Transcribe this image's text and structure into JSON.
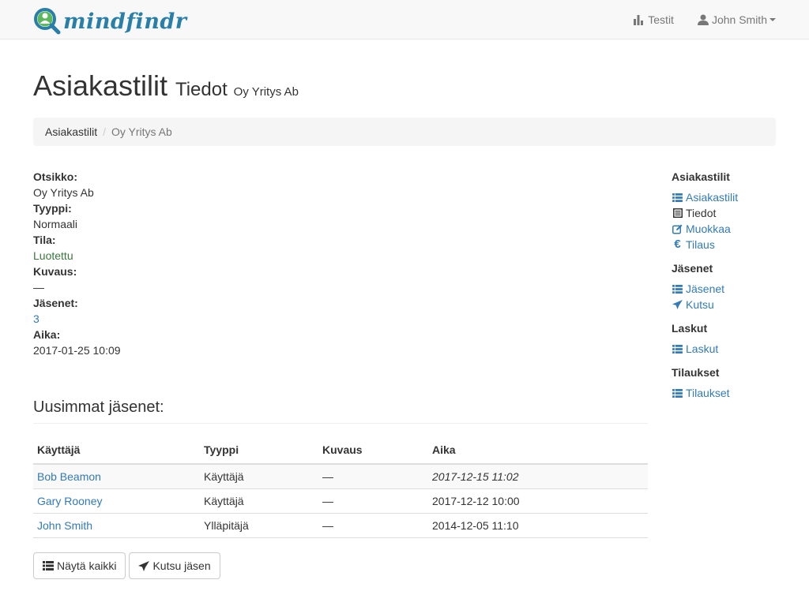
{
  "brand": {
    "name": "mindfindr"
  },
  "nav": {
    "tests_label": "Testit",
    "user_label": "John Smith"
  },
  "header": {
    "title": "Asiakastilit",
    "subtitle": "Tiedot",
    "account": "Oy Yritys Ab"
  },
  "breadcrumb": {
    "root": "Asiakastilit",
    "separator": "/",
    "current": "Oy Yritys Ab"
  },
  "details": [
    {
      "label": "Otsikko:",
      "value": "Oy Yritys Ab"
    },
    {
      "label": "Tyyppi:",
      "value": "Normaali"
    },
    {
      "label": "Tila:",
      "value": "Luotettu"
    },
    {
      "label": "Kuvaus:",
      "value": "—"
    },
    {
      "label": "Jäsenet:",
      "value": "3"
    },
    {
      "label": "Aika:",
      "value": "2017-01-25 10:09"
    }
  ],
  "members": {
    "title": "Uusimmat jäsenet:",
    "columns": [
      "Käyttäjä",
      "Tyyppi",
      "Kuvaus",
      "Aika"
    ],
    "rows": [
      {
        "user": "Bob Beamon",
        "type": "Käyttäjä",
        "desc": "—",
        "time": "2017-12-15 11:02"
      },
      {
        "user": "Gary Rooney",
        "type": "Käyttäjä",
        "desc": "—",
        "time": "2017-12-12 10:00"
      },
      {
        "user": "John Smith",
        "type": "Ylläpitäjä",
        "desc": "—",
        "time": "2014-12-05 11:10"
      }
    ],
    "show_all_label": "Näytä kaikki",
    "invite_label": "Kutsu jäsen"
  },
  "sidebar": {
    "groups": [
      {
        "heading": "Asiakastilit",
        "items": [
          {
            "label": "Asiakastilit",
            "icon": "list-icon"
          },
          {
            "label": "Tiedot",
            "icon": "details-icon"
          },
          {
            "label": "Muokkaa",
            "icon": "edit-icon"
          },
          {
            "label": "Tilaus",
            "icon": "euro-icon"
          }
        ]
      },
      {
        "heading": "Jäsenet",
        "items": [
          {
            "label": "Jäsenet",
            "icon": "list-icon"
          },
          {
            "label": "Kutsu",
            "icon": "send-icon"
          }
        ]
      },
      {
        "heading": "Laskut",
        "items": [
          {
            "label": "Laskut",
            "icon": "list-icon"
          }
        ]
      },
      {
        "heading": "Tilaukset",
        "items": [
          {
            "label": "Tilaukset",
            "icon": "list-icon"
          }
        ]
      }
    ]
  },
  "colors": {
    "link": "#337ab7",
    "brand": "#2a7fa8",
    "brand_green": "#5cb85c",
    "status_ok": "#3c763d"
  }
}
